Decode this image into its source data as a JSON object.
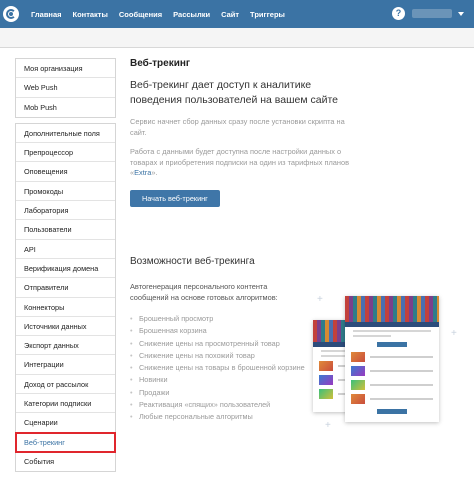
{
  "nav": {
    "items": [
      "Главная",
      "Контакты",
      "Сообщения",
      "Рассылки",
      "Сайт",
      "Триггеры"
    ],
    "help_label": "?"
  },
  "sidebar": {
    "group1": [
      "Моя организация",
      "Web Push",
      "Mob Push"
    ],
    "group2": [
      "Дополнительные поля",
      "Препроцессор",
      "Оповещения",
      "Промокоды",
      "Лаборатория",
      "Пользователи",
      "API",
      "Верификация домена",
      "Отправители",
      "Коннекторы",
      "Источники данных",
      "Экспорт данных",
      "Интеграции",
      "Доход от рассылок",
      "Категории подписки",
      "Сценарии",
      "Веб-трекинг",
      "События"
    ],
    "active": "Веб-трекинг"
  },
  "main": {
    "title": "Веб-трекинг",
    "lead": "Веб-трекинг дает доступ к аналитике поведения пользователей на вашем сайте",
    "p1": "Сервис начнет сбор данных сразу после установки скрипта на сайт.",
    "p2_prefix": "Работа с данными будет доступна после настройки данных о товарах и приобретения подписки на один из тарифных планов «",
    "p2_link": "Extra",
    "p2_suffix": "».",
    "cta": "Начать веб-трекинг",
    "features_title": "Возможности веб-трекинга",
    "features_lead": "Автогенерация персонального контента сообщений на основе готовых алгоритмов:",
    "features": [
      "Брошенный просмотр",
      "Брошенная корзина",
      "Снижение цены на просмотренный товар",
      "Снижение цены на похожий товар",
      "Снижение цены на товары в брошенной корзине",
      "Новинки",
      "Продажи",
      "Реактивация «спящих» пользователей",
      "Любые персональные алгоритмы"
    ]
  },
  "colors": {
    "brand": "#3b73a4",
    "active_outline": "#e0262d"
  }
}
